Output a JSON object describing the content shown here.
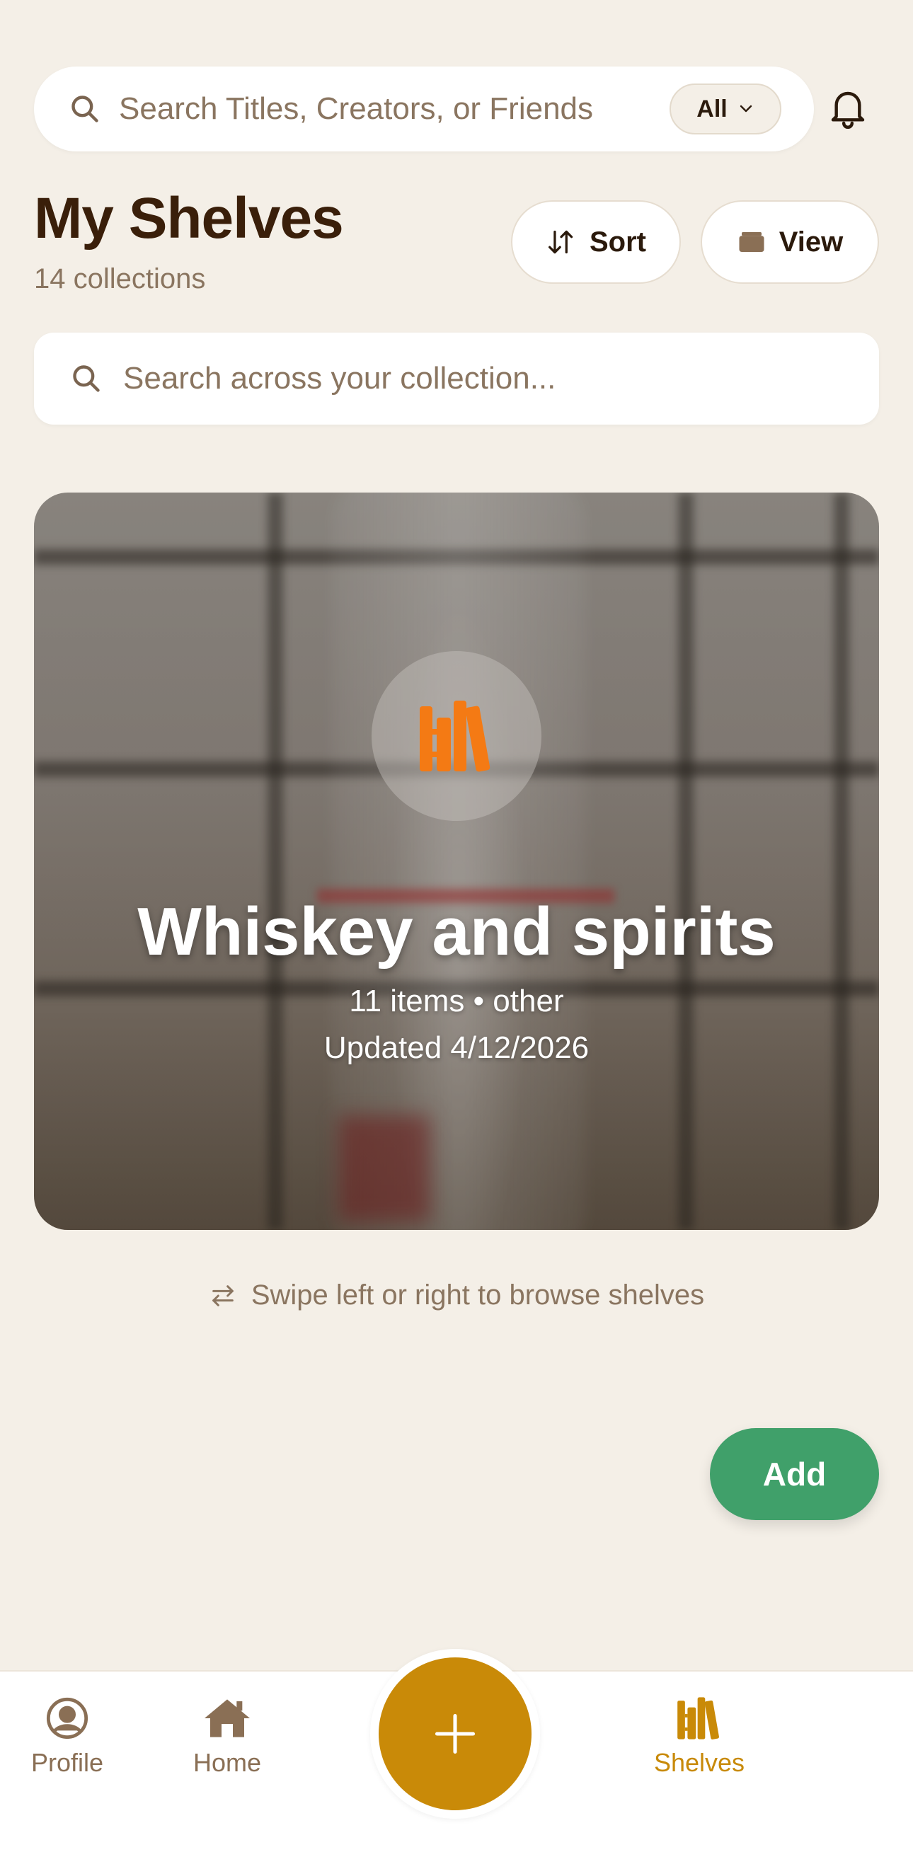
{
  "top_search": {
    "placeholder": "Search Titles, Creators, or Friends",
    "filter_label": "All"
  },
  "header": {
    "title": "My Shelves",
    "subtitle": "14 collections",
    "sort_label": "Sort",
    "view_label": "View"
  },
  "collection_search": {
    "placeholder": "Search across your collection..."
  },
  "shelf_card": {
    "title": "Whiskey and spirits",
    "meta": "11 items • other",
    "updated": "Updated 4/12/2026",
    "icon": "bookshelf-icon"
  },
  "swipe_hint": "Swipe left or right to browse shelves",
  "add_label": "Add",
  "bottom_nav": {
    "items": [
      {
        "label": "Profile",
        "icon": "profile-icon"
      },
      {
        "label": "Home",
        "icon": "home-icon"
      },
      {
        "label": "Shelves",
        "icon": "shelves-icon",
        "active": true
      }
    ],
    "center_button_icon": "plus-icon"
  },
  "colors": {
    "background": "#f4efe7",
    "accent": "#c98a08",
    "icon_orange": "#f47a14",
    "add_green": "#40a06a",
    "title_brown": "#3a1f0a",
    "muted_brown": "#8a7560"
  }
}
